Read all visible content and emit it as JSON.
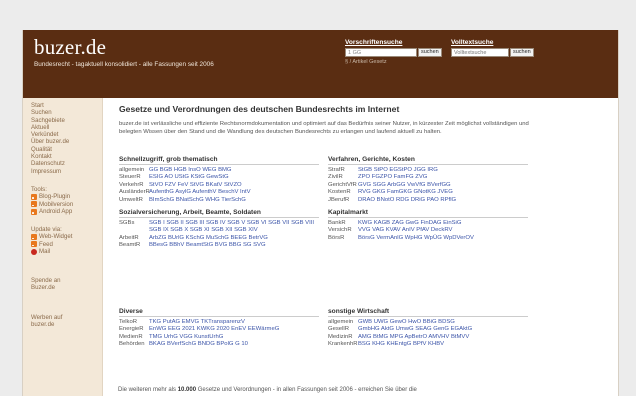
{
  "header": {
    "logo": "buzer.de",
    "tagline": "Bundesrecht - tagaktuell konsolidiert - alle Fassungen seit 2006",
    "vorschriftensuche": {
      "title": "Vorschriftensuche",
      "value": "1 GG",
      "button": "suchen",
      "hint": "§ / Artikel Gesetz"
    },
    "volltextsuche": {
      "title": "Volltextsuche",
      "placeholder": "Volltextsuche",
      "button": "suchen"
    }
  },
  "sidebar": {
    "nav": [
      "Start",
      "Suchen",
      "Sachgebiete",
      "Aktuell",
      "Verkündet",
      "Über buzer.de",
      "Qualität",
      "Kontakt",
      "Datenschutz",
      "Impressum"
    ],
    "tools_title": "Tools:",
    "tools": [
      {
        "label": "Blog-Plugin",
        "icon": "feed-icon"
      },
      {
        "label": "Mobilversion",
        "icon": "feed-icon"
      },
      {
        "label": "Android App",
        "icon": "feed-icon"
      }
    ],
    "update_title_1": "Update via:",
    "updates": [
      {
        "label": "Web-Widget",
        "icon": "feed-icon"
      },
      {
        "label": "Feed",
        "icon": "feed-icon"
      },
      {
        "label": "Mail",
        "icon": "mail-icon"
      }
    ],
    "spende": [
      "Spende an",
      "Buzer.de"
    ],
    "werben": [
      "Werben auf",
      "buzer.de"
    ]
  },
  "main": {
    "title": "Gesetze und Verordnungen des deutschen Bundesrechts im Internet",
    "intro": "buzer.de ist verlässliche und effiziente Rechtsnormdokumentation und optimiert auf das Bedürfnis seiner Nutzer, in kürzester Zeit möglichst vollständigen und belegten Wissen über den Stand und die Wandlung des deutschen Bundesrechts zu erlangen und laufend aktuell zu halten.",
    "sections": [
      {
        "heading": "Schnellzugriff, grob thematisch",
        "rows": [
          {
            "cat": "allgemein",
            "links": "GG BGB HGB InsO WEG BMG"
          },
          {
            "cat": "SteuerR",
            "links": "ESIG AO UStG KStG GewStG"
          },
          {
            "cat": "VerkehrR",
            "links": "StVO FZV FeV StVG BKatV StVZO"
          },
          {
            "cat": "AusländerR",
            "links": "AufenthG AsylG AufenthV BeschV IntV"
          },
          {
            "cat": "UmweltR",
            "links": "BImSchG BNatSchG WHG TierSchG"
          }
        ]
      },
      {
        "heading": "Verfahren, Gerichte, Kosten",
        "rows": [
          {
            "cat": "StrafR",
            "links": "StGB StPO EGStPO JGG IRG"
          },
          {
            "cat": "ZivilR",
            "links": "ZPO FGZPO FamFG ZVG"
          },
          {
            "cat": "GerichtVfR",
            "links": "GVG SGG ArbGG VwVfG BVerfGG"
          },
          {
            "cat": "KostenR",
            "links": "RVG GKG FamGKG GNotKG JVEG"
          },
          {
            "cat": "JBerufR",
            "links": "DRAO BNotO RDG DRiG PAO RPflG"
          }
        ]
      },
      {
        "heading": "Sozialversicherung, Arbeit, Beamte, Soldaten",
        "rows": [
          {
            "cat": "SGBs",
            "links": "SGB I SGB II SGB III SGB IV SGB V SGB VI SGB VII SGB VIII SGB IX SGB X SGB XI SGB XII SGB XIV"
          },
          {
            "cat": "ArbeitR",
            "links": "ArbZG BUrlG KSchG MuSchG BEEG BetrVG"
          },
          {
            "cat": "BeamtR",
            "links": "BBesG BBhV BeamtStG BVG BBG SG SVG"
          }
        ]
      },
      {
        "heading": "Kapitalmarkt",
        "rows": [
          {
            "cat": "BankR",
            "links": "KWG KAGB ZAG GwG FinDAG EinSiG"
          },
          {
            "cat": "VersichR",
            "links": "VVG VAG KVAV AnIV PfAV DeckRV"
          },
          {
            "cat": "BörsR",
            "links": "BörsG VermAnlG WpHG WpÜG WpDVerOV"
          }
        ]
      },
      {
        "heading": "Diverse",
        "rows": [
          {
            "cat": "TelkoR",
            "links": "TKG PutAG EMVG TKTransparenzV"
          },
          {
            "cat": "EnergieR",
            "links": "EnWG EEG 2021 KWKG 2020 EnEV EEWärmeG"
          },
          {
            "cat": "MedienR",
            "links": "TMG UrhG VGG KunstUrhG"
          },
          {
            "cat": "Behörden",
            "links": "BKAG BVerfSchG BNDG BPolG G 10"
          }
        ]
      },
      {
        "heading": "sonstige Wirtschaft",
        "rows": [
          {
            "cat": "allgemein",
            "links": "GWB UWG GewO HwO BBiG BDSG"
          },
          {
            "cat": "GesellR",
            "links": "GmbHG AktG UmwG SEAG GenG EGAktG"
          },
          {
            "cat": "MedizinR",
            "links": "AMG BtMG MPG ApBetrO AMVHV BtMVV"
          },
          {
            "cat": "KrankenhR",
            "links": "BSG KHG KHEntgG BPfV KHBV"
          }
        ]
      }
    ],
    "footer_pre": "Die weiteren mehr als ",
    "footer_bold": "10.000",
    "footer_post": " Gesetze und Verordnungen - in allen Fassungen seit 2006 - erreichen Sie über die"
  },
  "colors": {
    "header_bg": "#5a2d12",
    "sidebar_bg": "#f3e8d8",
    "link": "#3b54a8",
    "sidebar_link": "#8a6a4a"
  }
}
